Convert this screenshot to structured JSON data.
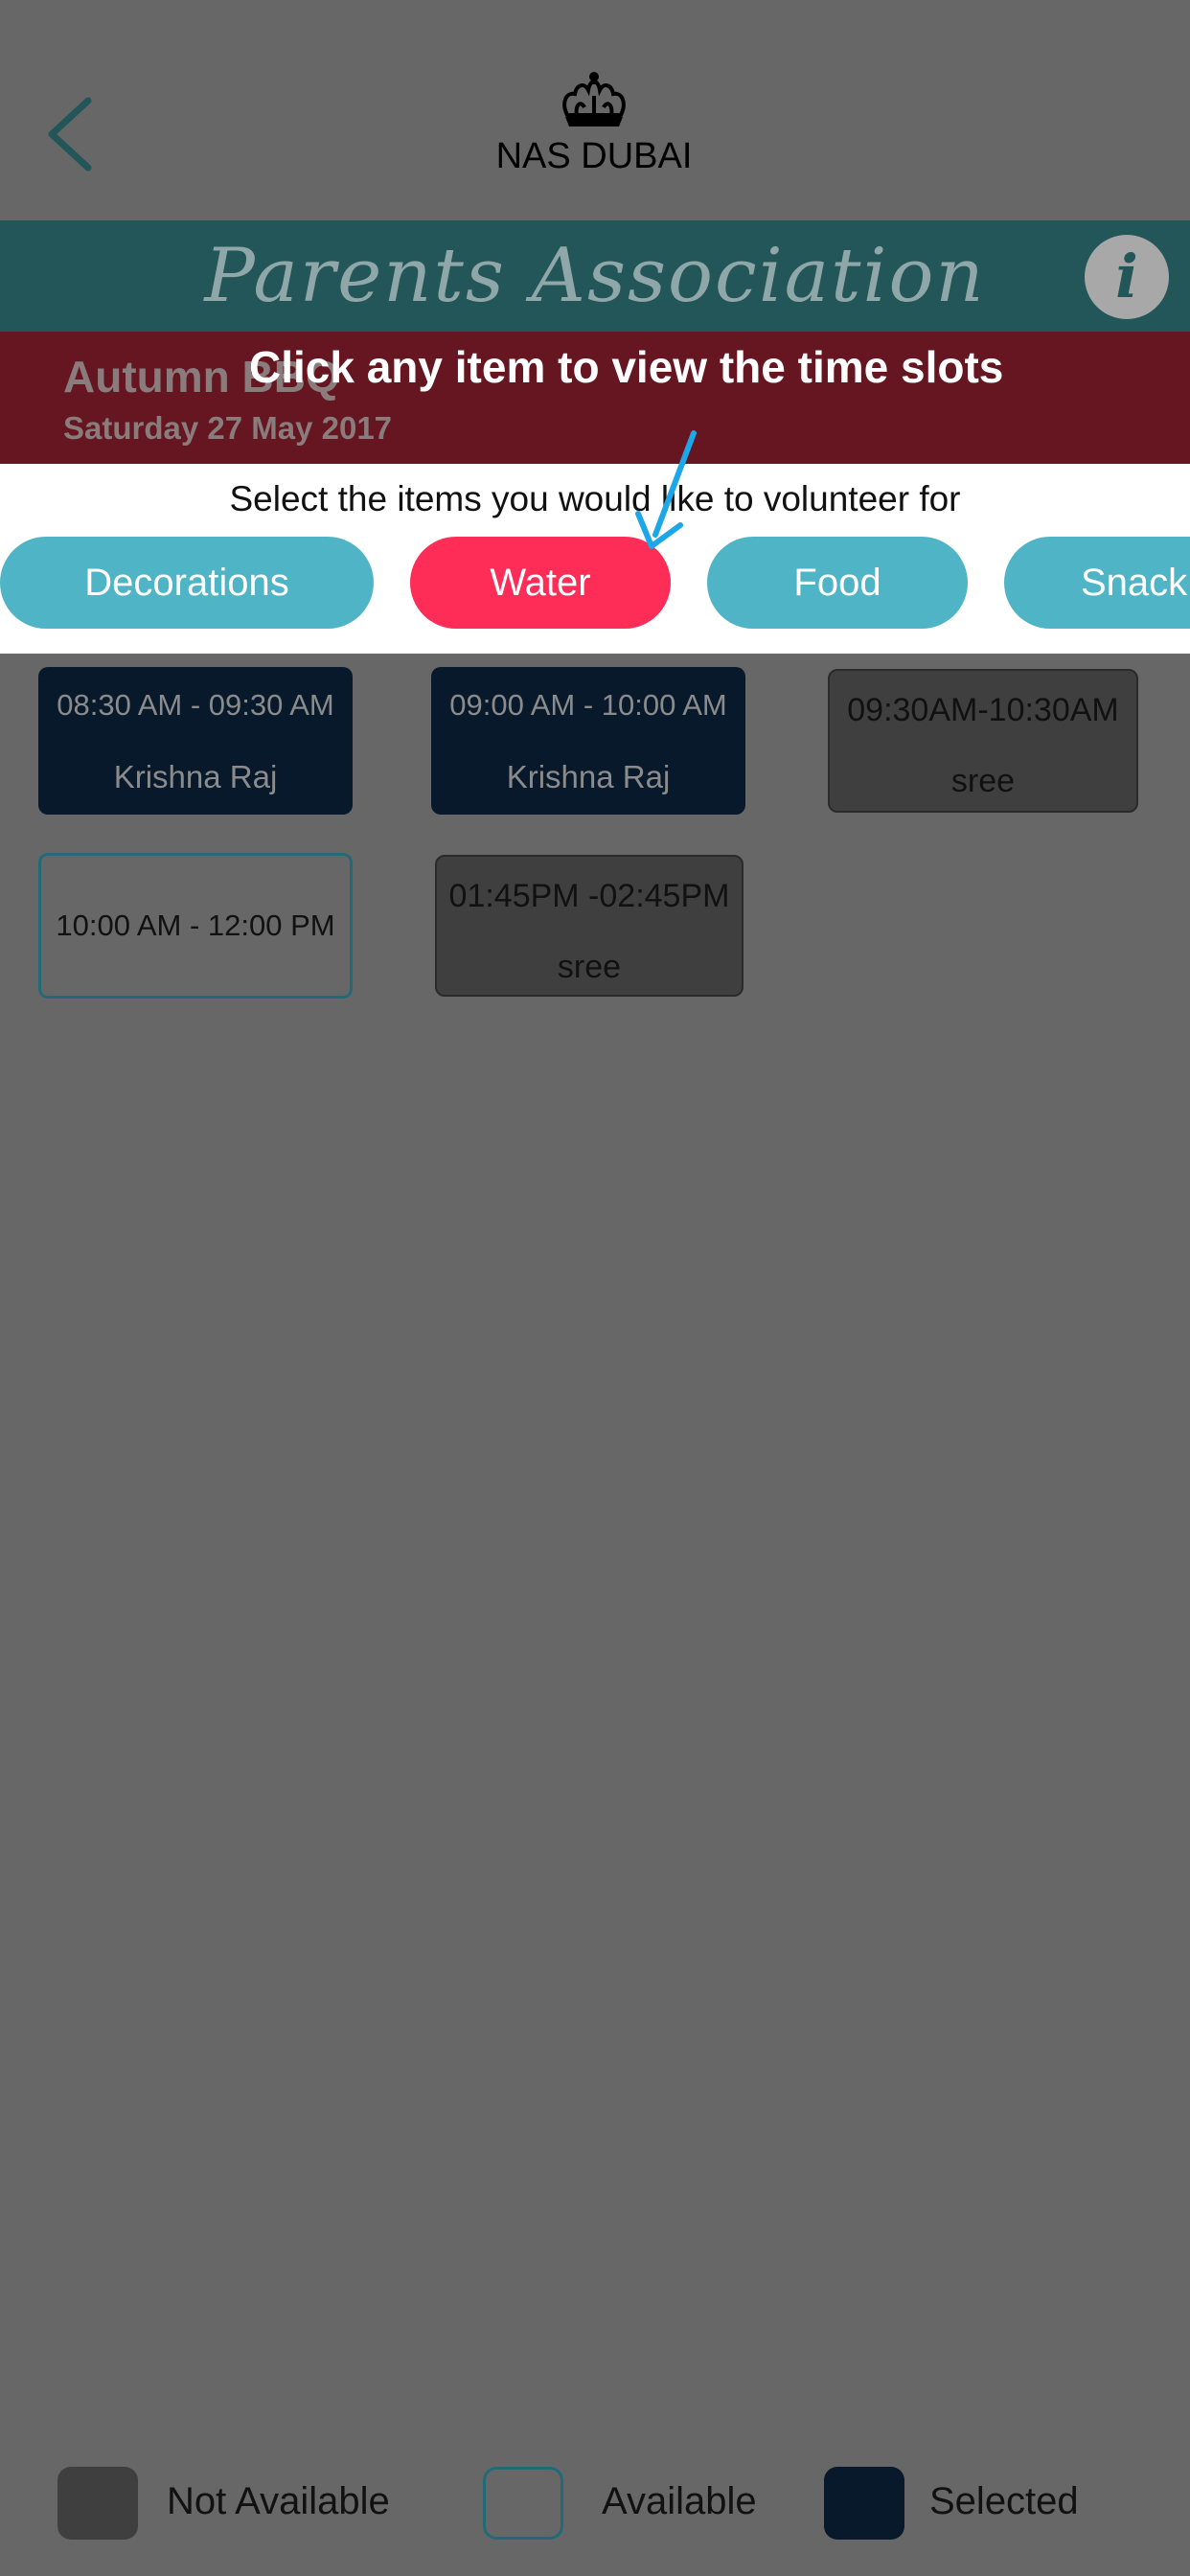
{
  "header": {
    "logo_text": "NAS DUBAI",
    "banner_title": "Parents Association",
    "info_label": "i"
  },
  "event": {
    "name": "Autumn BBQ",
    "date": "Saturday 27 May 2017"
  },
  "hint": "Click any item to view the time slots",
  "select_label": "Select the items you would like to volunteer for",
  "items": [
    {
      "label": "Decorations"
    },
    {
      "label": "Water"
    },
    {
      "label": "Food"
    },
    {
      "label": "Snack"
    }
  ],
  "slots": [
    {
      "time": "08:30 AM - 09:30 AM",
      "who": "Krishna Raj",
      "status": "selected"
    },
    {
      "time": "09:00 AM - 10:00 AM",
      "who": "Krishna Raj",
      "status": "selected"
    },
    {
      "time": "09:30AM-10:30AM",
      "who": "sree",
      "status": "not-available"
    },
    {
      "time": "10:00 AM - 12:00 PM",
      "who": "",
      "status": "available"
    },
    {
      "time": "01:45PM -02:45PM",
      "who": "sree",
      "status": "not-available"
    }
  ],
  "legend": {
    "not_available": "Not Available",
    "available": "Available",
    "selected": "Selected"
  },
  "colors": {
    "overlay": "#676767",
    "banner": "#235659",
    "event_bar": "#661620",
    "pill": "#4fb5c6",
    "pill_active": "#fe2d57",
    "selected": "#07192a",
    "not_available": "#3f3f3f",
    "arrow": "#1ea7e8"
  }
}
